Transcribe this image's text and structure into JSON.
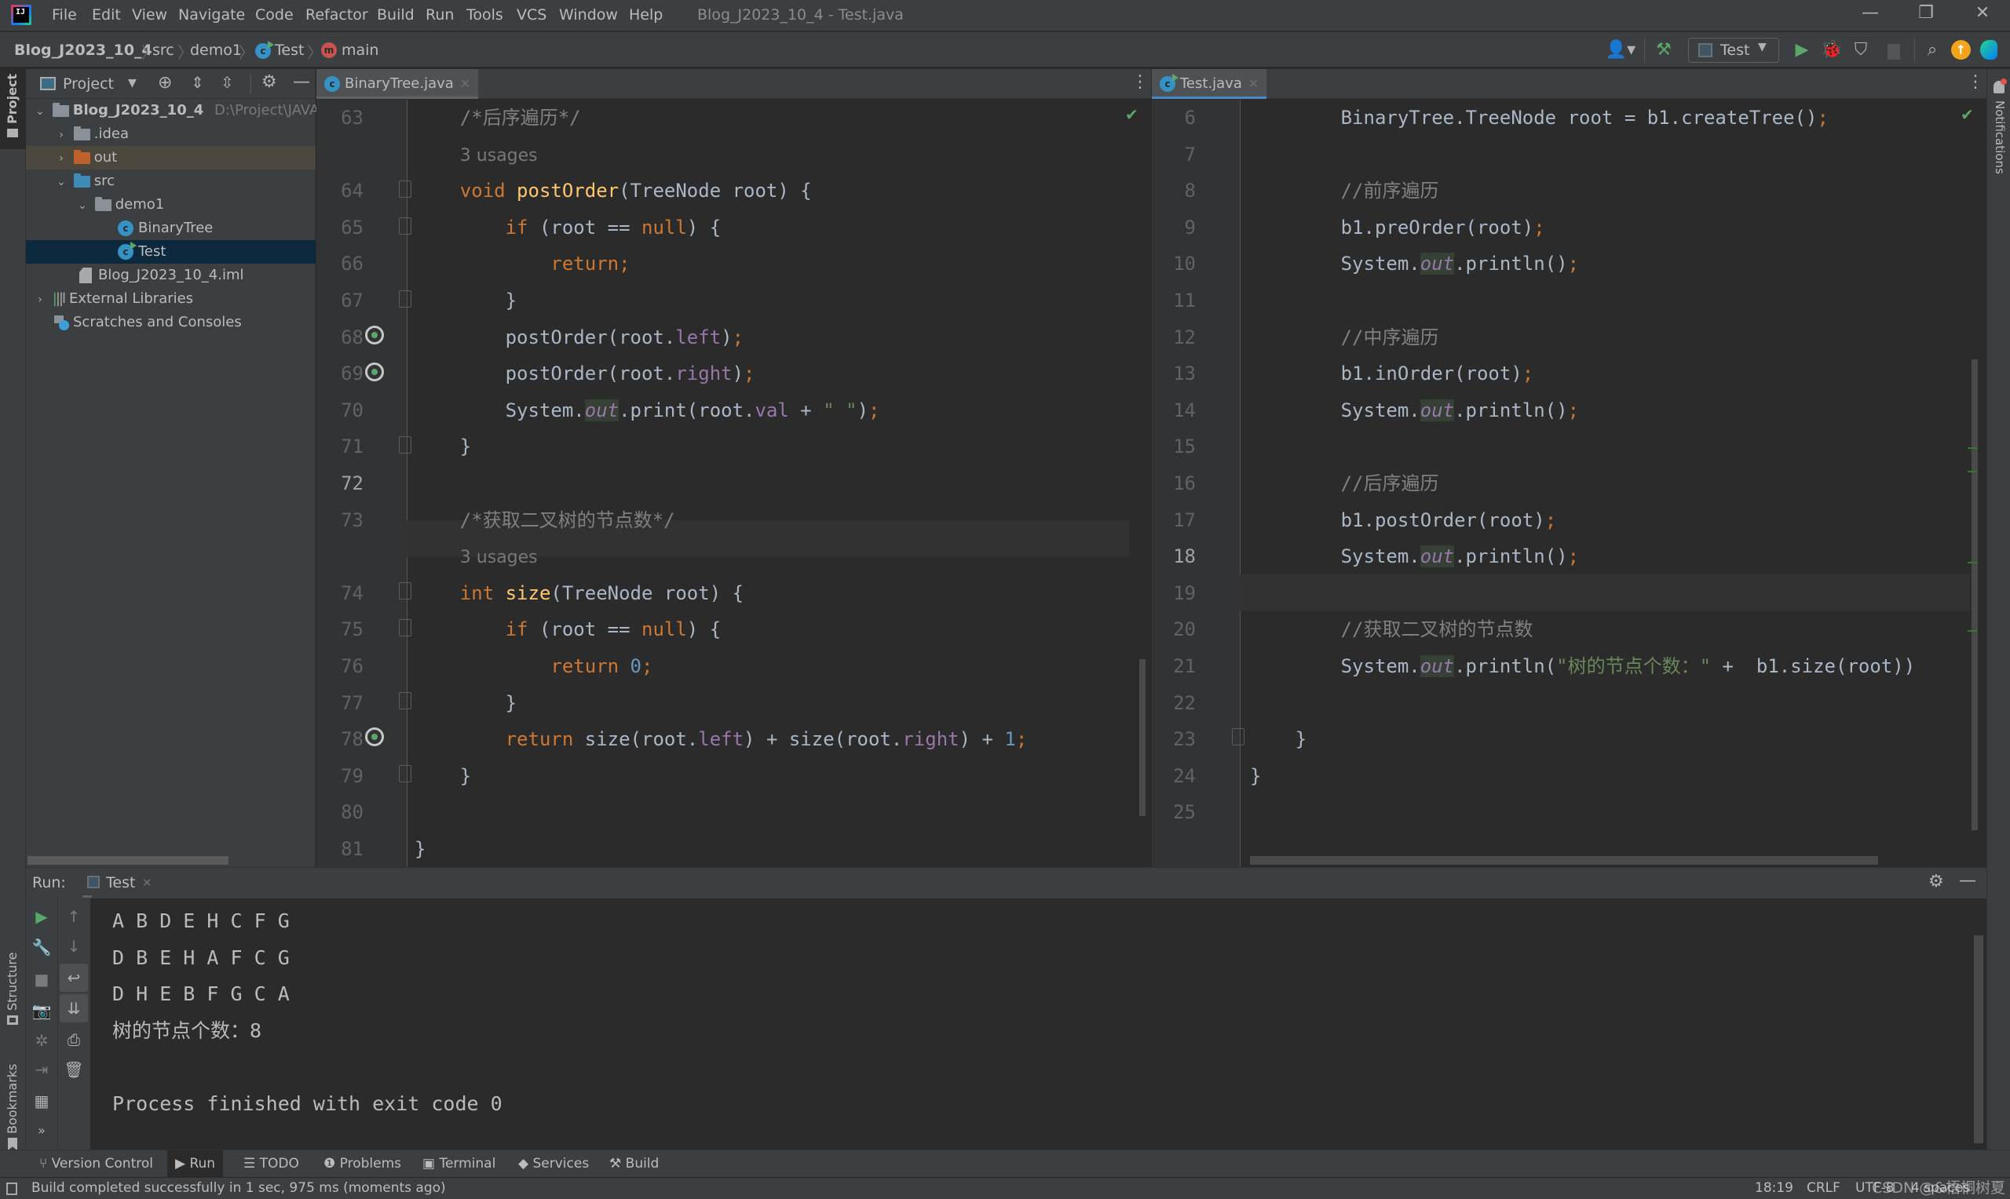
{
  "menubar": {
    "items": [
      "File",
      "Edit",
      "View",
      "Navigate",
      "Code",
      "Refactor",
      "Build",
      "Run",
      "Tools",
      "VCS",
      "Window",
      "Help"
    ],
    "window_title": "Blog_J2023_10_4 - Test.java",
    "controls": {
      "minimize": "—",
      "restore": "❐",
      "close": "✕"
    }
  },
  "breadcrumb": {
    "project": "Blog_J2023_10_4",
    "items": [
      "src",
      "demo1",
      "Test",
      "main"
    ]
  },
  "toolbar": {
    "run_config": "Test",
    "icons": [
      "user-icon",
      "build-hammer-icon",
      "run-icon",
      "debug-icon",
      "coverage-icon",
      "stop-icon",
      "search-icon",
      "update-icon",
      "toolbox-icon"
    ]
  },
  "left_stripe": {
    "project": "Project",
    "structure": "Structure",
    "bookmarks": "Bookmarks"
  },
  "right_stripe": {
    "notifications": "Notifications"
  },
  "project_panel": {
    "title": "Project",
    "tree": [
      {
        "label": "Blog_J2023_10_4",
        "extra": "D:\\Project\\JAVA\\",
        "depth": 0,
        "expanded": true,
        "type": "module"
      },
      {
        "label": ".idea",
        "depth": 1,
        "expanded": false,
        "type": "folder"
      },
      {
        "label": "out",
        "depth": 1,
        "expanded": false,
        "type": "folder-excluded"
      },
      {
        "label": "src",
        "depth": 1,
        "expanded": true,
        "type": "folder-src"
      },
      {
        "label": "demo1",
        "depth": 2,
        "expanded": true,
        "type": "package"
      },
      {
        "label": "BinaryTree",
        "depth": 3,
        "type": "class"
      },
      {
        "label": "Test",
        "depth": 3,
        "type": "class-run",
        "selected": true
      },
      {
        "label": "Blog_J2023_10_4.iml",
        "depth": 1,
        "type": "iml"
      },
      {
        "label": "External Libraries",
        "depth": 0,
        "expanded": false,
        "type": "libs"
      },
      {
        "label": "Scratches and Consoles",
        "depth": 0,
        "type": "scratches"
      }
    ]
  },
  "left_editor": {
    "tab": "BinaryTree.java",
    "line_numbers": [
      "63",
      "",
      "64",
      "65",
      "66",
      "67",
      "68",
      "69",
      "70",
      "71",
      "72",
      "73",
      "",
      "74",
      "75",
      "76",
      "77",
      "78",
      "79",
      "80",
      "81"
    ],
    "lines": [
      "    /*后序遍历*/",
      "    3 usages",
      "    void postOrder(TreeNode root) {",
      "        if (root == null) {",
      "            return;",
      "        }",
      "        postOrder(root.left);",
      "        postOrder(root.right);",
      "        System.out.print(root.val + \" \");",
      "    }",
      "",
      "    /*获取二叉树的节点数*/",
      "    3 usages",
      "    int size(TreeNode root) {",
      "        if (root == null) {",
      "            return 0;",
      "        }",
      "        return size(root.left) + size(root.right) + 1;",
      "    }",
      "",
      "}"
    ],
    "current_line": "72"
  },
  "right_editor": {
    "tab": "Test.java",
    "line_numbers": [
      "6",
      "7",
      "8",
      "9",
      "10",
      "11",
      "12",
      "13",
      "14",
      "15",
      "16",
      "17",
      "18",
      "19",
      "20",
      "21",
      "22",
      "23",
      "24",
      "25"
    ],
    "lines": [
      "        BinaryTree.TreeNode root = b1.createTree();",
      "",
      "        //前序遍历",
      "        b1.preOrder(root);",
      "        System.out.println();",
      "",
      "        //中序遍历",
      "        b1.inOrder(root);",
      "        System.out.println();",
      "",
      "        //后序遍历",
      "        b1.postOrder(root);",
      "        System.out.println();",
      "",
      "        //获取二叉树的节点数",
      "        System.out.println(\"树的节点个数：\" +  b1.size(root))",
      "",
      "    }",
      "}",
      ""
    ],
    "current_line": "18"
  },
  "run_panel": {
    "label": "Run:",
    "tab": "Test",
    "output": [
      "A B D E H C F G",
      "D B E H A F C G",
      "D H E B F G C A",
      "树的节点个数：8",
      "",
      "Process finished with exit code 0"
    ]
  },
  "bottom_tabs": [
    {
      "label": "Version Control",
      "icon": "⑂"
    },
    {
      "label": "Run",
      "icon": "▶",
      "active": true
    },
    {
      "label": "TODO",
      "icon": "☰"
    },
    {
      "label": "Problems",
      "icon": "❶"
    },
    {
      "label": "Terminal",
      "icon": "▣"
    },
    {
      "label": "Services",
      "icon": "◆"
    },
    {
      "label": "Build",
      "icon": "⚒"
    }
  ],
  "statusbar": {
    "message": "Build completed successfully in 1 sec, 975 ms (moments ago)",
    "position": "18:19",
    "line_sep": "CRLF",
    "encoding": "UTF-8",
    "indent": "4 spaces",
    "watermark": "CSDN @&梧桐树夏"
  },
  "colors": {
    "accent": "#4a88c7",
    "run_green": "#59a869",
    "keyword": "#cc7832",
    "function": "#ffc66d",
    "field": "#9876aa",
    "comment": "#808080",
    "number": "#6897bb",
    "string": "#6a8759"
  }
}
